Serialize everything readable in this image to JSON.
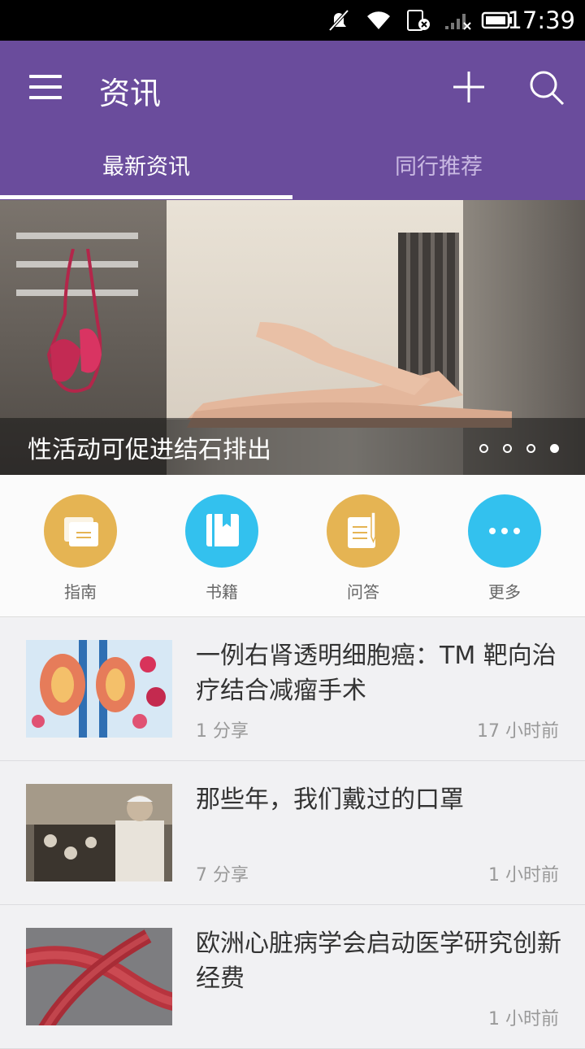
{
  "status_bar": {
    "time": "17:39"
  },
  "app_bar": {
    "title": "资讯"
  },
  "tabs": [
    {
      "label": "最新资讯",
      "active": true
    },
    {
      "label": "同行推荐",
      "active": false
    }
  ],
  "banner": {
    "caption": "性活动可促进结石排出",
    "total_slides": 4,
    "active_slide": 4
  },
  "shortcuts": [
    {
      "label": "指南",
      "icon": "guide-icon",
      "color": "#e5b453"
    },
    {
      "label": "书籍",
      "icon": "book-icon",
      "color": "#33c1ee"
    },
    {
      "label": "问答",
      "icon": "qa-icon",
      "color": "#e5b453"
    },
    {
      "label": "更多",
      "icon": "more-icon",
      "color": "#33c1ee"
    }
  ],
  "news": [
    {
      "title": "一例右肾透明细胞癌：TM 靶向治疗结合减瘤手术",
      "shares": "1 分享",
      "time": "17 小时前",
      "thumb": "kidney-image"
    },
    {
      "title": "那些年，我们戴过的口罩",
      "shares": "7 分享",
      "time": "1 小时前",
      "thumb": "scientist-photo"
    },
    {
      "title": "欧洲心脏病学会启动医学研究创新经费",
      "shares": "",
      "time": "1 小时前",
      "thumb": "blood-vessel-image"
    }
  ],
  "colors": {
    "primary": "#6a4c9c",
    "accent_yellow": "#e5b453",
    "accent_blue": "#33c1ee"
  }
}
